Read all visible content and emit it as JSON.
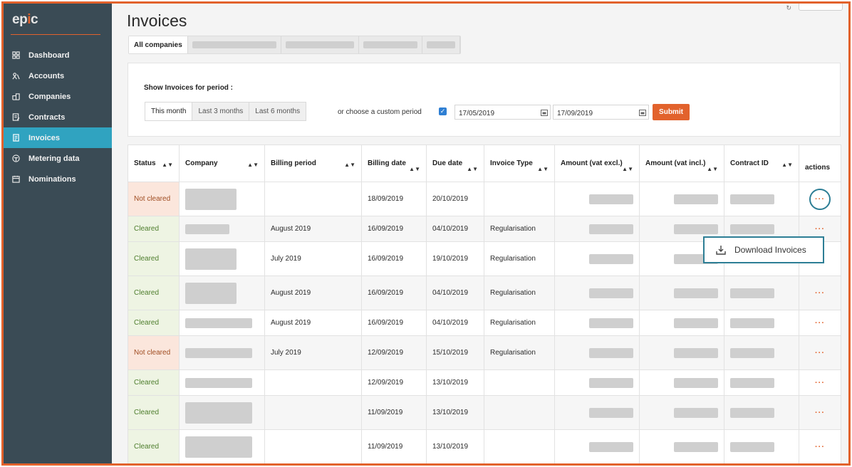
{
  "app": {
    "logo_text_a": "ep",
    "logo_text_b": "i",
    "logo_text_c": "c"
  },
  "sidebar": {
    "items": [
      {
        "label": "Dashboard",
        "icon": "dashboard-icon"
      },
      {
        "label": "Accounts",
        "icon": "accounts-icon"
      },
      {
        "label": "Companies",
        "icon": "companies-icon"
      },
      {
        "label": "Contracts",
        "icon": "contracts-icon"
      },
      {
        "label": "Invoices",
        "icon": "invoices-icon",
        "active": true
      },
      {
        "label": "Metering data",
        "icon": "metering-icon"
      },
      {
        "label": "Nominations",
        "icon": "nominations-icon"
      }
    ]
  },
  "page": {
    "title": "Invoices"
  },
  "company_tabs": {
    "all_label": "All companies"
  },
  "period": {
    "label": "Show Invoices for period :",
    "options": [
      "This month",
      "Last 3 months",
      "Last 6 months"
    ],
    "selected": "This month",
    "custom_label": "or choose a custom period",
    "custom_checked": true,
    "from": "17/05/2019",
    "to": "17/09/2019",
    "submit_label": "Submit"
  },
  "table": {
    "headers": {
      "status": "Status",
      "company": "Company",
      "billing_period": "Billing period",
      "billing_date": "Billing date",
      "due_date": "Due date",
      "invoice_type": "Invoice Type",
      "amount_excl": "Amount (vat excl.)",
      "amount_incl": "Amount (vat incl.)",
      "contract_id": "Contract ID",
      "actions": "actions"
    },
    "rows": [
      {
        "status": "Not cleared",
        "billing_period": "",
        "billing_date": "18/09/2019",
        "due_date": "20/10/2019",
        "invoice_type": "",
        "actions": "···"
      },
      {
        "status": "Cleared",
        "billing_period": "August 2019",
        "billing_date": "16/09/2019",
        "due_date": "04/10/2019",
        "invoice_type": "Regularisation",
        "actions": "···"
      },
      {
        "status": "Cleared",
        "billing_period": "July 2019",
        "billing_date": "16/09/2019",
        "due_date": "19/10/2019",
        "invoice_type": "Regularisation",
        "actions": ""
      },
      {
        "status": "Cleared",
        "billing_period": "August 2019",
        "billing_date": "16/09/2019",
        "due_date": "04/10/2019",
        "invoice_type": "Regularisation",
        "actions": "···"
      },
      {
        "status": "Cleared",
        "billing_period": "August 2019",
        "billing_date": "16/09/2019",
        "due_date": "04/10/2019",
        "invoice_type": "Regularisation",
        "actions": "···"
      },
      {
        "status": "Not cleared",
        "billing_period": "July 2019",
        "billing_date": "12/09/2019",
        "due_date": "15/10/2019",
        "invoice_type": "Regularisation",
        "actions": "···"
      },
      {
        "status": "Cleared",
        "billing_period": "",
        "billing_date": "12/09/2019",
        "due_date": "13/10/2019",
        "invoice_type": "",
        "actions": "···"
      },
      {
        "status": "Cleared",
        "billing_period": "",
        "billing_date": "11/09/2019",
        "due_date": "13/10/2019",
        "invoice_type": "",
        "actions": "···"
      },
      {
        "status": "Cleared",
        "billing_period": "",
        "billing_date": "11/09/2019",
        "due_date": "13/10/2019",
        "invoice_type": "",
        "actions": "···"
      }
    ]
  },
  "dropdown": {
    "label": "Download Invoices",
    "icon": "download-icon"
  },
  "colors": {
    "accent": "#e2622c",
    "sidebar": "#3a4b55",
    "active_nav": "#30a3c0",
    "focus": "#2d7e95"
  }
}
